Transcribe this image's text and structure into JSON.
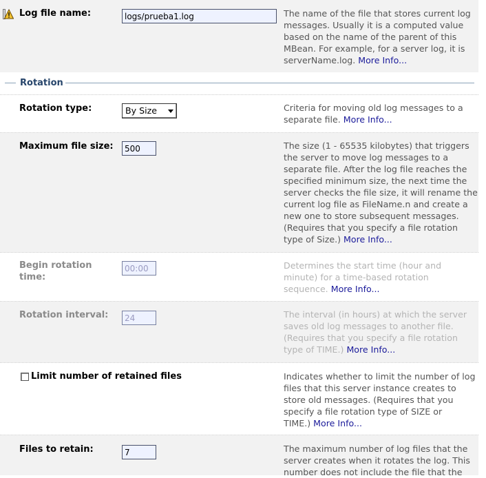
{
  "log_file_name": {
    "label": "Log file name:",
    "value": "logs/prueba1.log",
    "description": "The name of the file that stores current log messages. Usually it is a computed value based on the name of the parent of this MBean. For example, for a server log, it is serverName.log.",
    "more_info": "More Info..."
  },
  "rotation_section": {
    "title": "Rotation"
  },
  "rotation_type": {
    "label": "Rotation type:",
    "selected": "By Size",
    "description": "Criteria for moving old log messages to a separate file.",
    "more_info": "More Info..."
  },
  "max_file_size": {
    "label": "Maximum file size:",
    "value": "500",
    "description": "The size (1 - 65535 kilobytes) that triggers the server to move log messages to a separate file. After the log file reaches the specified minimum size, the next time the server checks the file size, it will rename the current log file as FileName.n and create a new one to store subsequent messages. (Requires that you specify a file rotation type of Size.)",
    "more_info": "More Info..."
  },
  "begin_rotation_time": {
    "label": "Begin rotation time:",
    "value": "00:00",
    "description": "Determines the start time (hour and minute) for a time-based rotation sequence.",
    "more_info": "More Info..."
  },
  "rotation_interval": {
    "label": "Rotation interval:",
    "value": "24",
    "description": "The interval (in hours) at which the server saves old log messages to another file. (Requires that you specify a file rotation type of TIME.)",
    "more_info": "More Info..."
  },
  "limit_retained": {
    "label": "Limit number of retained files",
    "checked": false,
    "description": "Indicates whether to limit the number of log files that this server instance creates to store old messages. (Requires that you specify a file rotation type of SIZE or TIME.)",
    "more_info": "More Info..."
  },
  "files_to_retain": {
    "label": "Files to retain:",
    "value": "7",
    "description": "The maximum number of log files that the server creates when it rotates the log. This number does not include the file that the",
    "more_info": ""
  },
  "colors": {
    "row_gray": "#f2f2f2",
    "section_title": "#27456b",
    "link": "#1a1a9a",
    "input_bg": "#eef2ff",
    "disabled_text": "#b4b4b4"
  },
  "icons": {
    "warning": "warning-icon"
  }
}
